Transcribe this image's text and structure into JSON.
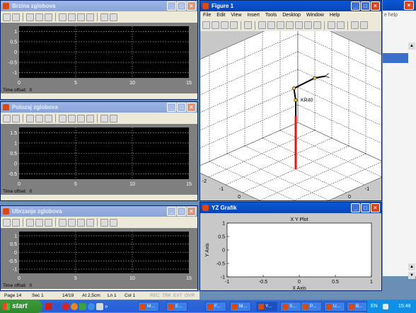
{
  "scopes": [
    {
      "title": "Brzina zglobova",
      "active": false,
      "y_ticks": [
        "1",
        "0.5",
        "0",
        "-0.5",
        "-1"
      ],
      "x_ticks": [
        "0",
        "5",
        "10",
        "15"
      ],
      "time_offset_label": "Time offset:",
      "time_offset_value": "0"
    },
    {
      "title": "Polozaj zglobova",
      "active": false,
      "y_ticks": [
        "1.5",
        "1",
        "0.5",
        "0",
        "-0.5"
      ],
      "x_ticks": [
        "0",
        "5",
        "10",
        "15"
      ],
      "time_offset_label": "Time offset:",
      "time_offset_value": "0"
    },
    {
      "title": "Ubrzanje zglobova",
      "active": false,
      "y_ticks": [
        "1",
        "0.5",
        "0",
        "-0.5",
        "-1"
      ],
      "x_ticks": [
        "0",
        "5",
        "10",
        "15"
      ],
      "time_offset_label": "Time offset:",
      "time_offset_value": "0"
    }
  ],
  "scope_toolbar_icons": [
    "print-icon",
    "parameters-icon",
    "zoom-icon",
    "zoom-x-icon",
    "zoom-y-icon",
    "autoscale-icon",
    "save-axes-icon",
    "restore-axes-icon",
    "floating-scope-icon",
    "lock-axes-icon",
    "signal-selector-icon"
  ],
  "figure": {
    "title": "Figure 1",
    "menu": [
      "File",
      "Edit",
      "View",
      "Insert",
      "Tools",
      "Desktop",
      "Window",
      "Help"
    ],
    "toolbar_icons": [
      "new-icon",
      "open-icon",
      "save-icon",
      "print-icon",
      "pointer-icon",
      "zoom-in-icon",
      "zoom-out-icon",
      "pan-icon",
      "rotate-icon",
      "datacursor-icon",
      "brush-icon",
      "link-icon",
      "colorbar-icon",
      "legend-icon",
      "hide-tools-icon",
      "show-tools-icon"
    ],
    "plot": {
      "z_label": "Z",
      "x_label": "X",
      "y_label": "Y",
      "z_ticks": [
        "2",
        "1",
        "0",
        "-1",
        "-2"
      ],
      "x_ticks": [
        "-2",
        "-1",
        "0",
        "1",
        "2"
      ],
      "y_ticks": [
        "2",
        "1",
        "0",
        "-1",
        "-2"
      ],
      "robot_name": "KR40",
      "colors": {
        "base": "#dd1a12",
        "link": "#000000",
        "joint": "#e8c840"
      }
    }
  },
  "yz": {
    "title": "YZ Grafik",
    "plot_title": "X Y Plot",
    "xlabel": "X Axis",
    "ylabel": "Y Axis",
    "x_ticks": [
      "-1",
      "-0.5",
      "0",
      "0.5",
      "1"
    ],
    "y_ticks": [
      "1",
      "0.5",
      "0",
      "-0.5",
      "-1"
    ],
    "xlim": [
      -1,
      1
    ],
    "ylim": [
      -1,
      1
    ]
  },
  "background_window": {
    "text_fragment": "e help",
    "scroll_up": "▲",
    "scroll_down": "▼"
  },
  "status_bar": {
    "page": "Page 14",
    "sec": "Sec 1",
    "pages": "14/19",
    "at": "At 2,5cm",
    "ln": "Ln 1",
    "col": "Col 1",
    "rec": "REC",
    "trk": "TRK",
    "ext": "EXT",
    "ovr": "OVR"
  },
  "taskbar": {
    "start_label": "start",
    "tasks": [
      "M...",
      "E...",
      "F...",
      "M...",
      "Y...",
      "S...",
      "P...",
      "U...",
      "B..."
    ],
    "language": "EN",
    "clock": "15:48"
  }
}
